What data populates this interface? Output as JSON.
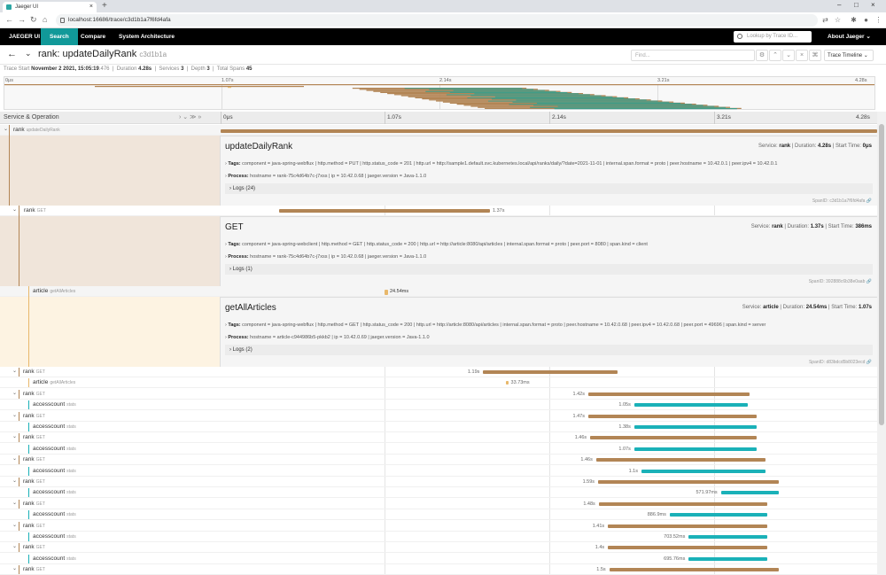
{
  "browser": {
    "tab_title": "Jaeger UI",
    "url": "localhost:16686/trace/c3d1b1a7f6fd4afa"
  },
  "nav": {
    "brand": "JAEGER UI",
    "items": [
      "Search",
      "Compare",
      "System Architecture"
    ],
    "lookup_placeholder": "Lookup by Trace ID...",
    "about": "About Jaeger"
  },
  "trace": {
    "service": "rank",
    "name": "rank: updateDailyRank",
    "short_id": "c3d1b1a",
    "find_placeholder": "Find...",
    "view": "Trace Timeline",
    "meta": {
      "start_label": "Trace Start",
      "start": "November 2 2021, 15:05:19",
      "start_ms": ".476",
      "duration_label": "Duration",
      "duration": "4.28s",
      "services_label": "Services",
      "services": "3",
      "depth_label": "Depth",
      "depth": "3",
      "spans_label": "Total Spans",
      "spans": "45"
    }
  },
  "minimap": {
    "ticks": [
      "0μs",
      "1.07s",
      "2.14s",
      "3.21s",
      "4.28s"
    ]
  },
  "timeline": {
    "header": "Service & Operation",
    "ticks": [
      "0μs",
      "1.07s",
      "2.14s",
      "3.21s",
      "4.28s"
    ]
  },
  "spans": [
    {
      "service": "rank",
      "op": "updateDailyRank",
      "title": "updateDailyRank",
      "svc_label": "Service:",
      "svc": "rank",
      "dur_label": "Duration:",
      "dur": "4.28s",
      "start_label": "Start Time:",
      "start": "0μs",
      "tags_label": "Tags:",
      "tags": "component = java-spring-webflux   |   http.method = PUT   |   http.status_code = 201   |   http.url = http://sample1.default.svc.kubernetes.local/api/ranks/daily/?date=2021-11-01   |   internal.span.format = proto   |   peer.hostname = 10.42.0.1   |   peer.ipv4 = 10.42.0.1",
      "process_label": "Process:",
      "process": "hostname = rank-75c4d64b7c-j7xss   |   ip = 10.42.0.68   |   jaeger.version = Java-1.1.0",
      "logs_label": "Logs",
      "logs": "(24)",
      "spanid_label": "SpanID:",
      "spanid": "c3d1b1a7f6fd4afa"
    },
    {
      "service": "rank",
      "op": "GET",
      "title": "GET",
      "bar": "1.37s",
      "svc_label": "Service:",
      "svc": "rank",
      "dur_label": "Duration:",
      "dur": "1.37s",
      "start_label": "Start Time:",
      "start": "386ms",
      "tags_label": "Tags:",
      "tags": "component = java-spring-webclient   |   http.method = GET   |   http.status_code = 200   |   http.url = http://article:8080/api/articles   |   internal.span.format = proto   |   peer.port = 8080   |   span.kind = client",
      "process_label": "Process:",
      "process": "hostname = rank-75c4d64b7c-j7xss   |   ip = 10.42.0.68   |   jaeger.version = Java-1.1.0",
      "logs_label": "Logs",
      "logs": "(1)",
      "spanid_label": "SpanID:",
      "spanid": "392888c6b38e0aab"
    },
    {
      "service": "article",
      "op": "getAllArticles",
      "title": "getAllArticles",
      "bar": "24.54ms",
      "svc_label": "Service:",
      "svc": "article",
      "dur_label": "Duration:",
      "dur": "24.54ms",
      "start_label": "Start Time:",
      "start": "1.07s",
      "tags_label": "Tags:",
      "tags": "component = java-spring-webflux   |   http.method = GET   |   http.status_code = 200   |   http.url = http://article:8080/api/articles   |   internal.span.format = proto   |   peer.hostname = 10.42.0.68   |   peer.ipv4 = 10.42.0.68   |   peer.port = 49696   |   span.kind = server",
      "process_label": "Process:",
      "process": "hostname = article-c944986b5-pkkb2   |   ip = 10.42.0.69   |   jaeger.version = Java-1.1.0",
      "logs_label": "Logs",
      "logs": "(2)",
      "spanid_label": "SpanID:",
      "spanid": "d83bdcd5b8023ecd"
    }
  ],
  "rows": [
    {
      "service": "rank",
      "op": "GET",
      "label": "1.19s",
      "start": 0.4,
      "end": 0.605,
      "kind": "rank",
      "child": false
    },
    {
      "service": "article",
      "op": "getAllArticles",
      "label": "33.73ms",
      "start": 0.4345,
      "end": 0.438,
      "kind": "art",
      "child": true
    },
    {
      "service": "rank",
      "op": "GET",
      "label": "1.42s",
      "start": 0.56,
      "end": 0.806,
      "kind": "rank",
      "child": false
    },
    {
      "service": "accesscount",
      "op": "stats",
      "label": "1.05s",
      "start": 0.63,
      "end": 0.803,
      "kind": "acc",
      "child": true
    },
    {
      "service": "rank",
      "op": "GET",
      "label": "1.47s",
      "start": 0.56,
      "end": 0.816,
      "kind": "rank",
      "child": false
    },
    {
      "service": "accesscount",
      "op": "stats",
      "label": "1.38s",
      "start": 0.63,
      "end": 0.816,
      "kind": "acc",
      "child": true
    },
    {
      "service": "rank",
      "op": "GET",
      "label": "1.46s",
      "start": 0.563,
      "end": 0.816,
      "kind": "rank",
      "child": false
    },
    {
      "service": "accesscount",
      "op": "stats",
      "label": "1.07s",
      "start": 0.63,
      "end": 0.816,
      "kind": "acc",
      "child": true
    },
    {
      "service": "rank",
      "op": "GET",
      "label": "1.46s",
      "start": 0.572,
      "end": 0.83,
      "kind": "rank",
      "child": false
    },
    {
      "service": "accesscount",
      "op": "stats",
      "label": "1.1s",
      "start": 0.641,
      "end": 0.83,
      "kind": "acc",
      "child": true
    },
    {
      "service": "rank",
      "op": "GET",
      "label": "1.59s",
      "start": 0.575,
      "end": 0.85,
      "kind": "rank",
      "child": false
    },
    {
      "service": "accesscount",
      "op": "stats",
      "label": "571.97ms",
      "start": 0.762,
      "end": 0.85,
      "kind": "acc",
      "child": true
    },
    {
      "service": "rank",
      "op": "GET",
      "label": "1.48s",
      "start": 0.576,
      "end": 0.832,
      "kind": "rank",
      "child": false
    },
    {
      "service": "accesscount",
      "op": "stats",
      "label": "886.9ms",
      "start": 0.684,
      "end": 0.832,
      "kind": "acc",
      "child": true
    },
    {
      "service": "rank",
      "op": "GET",
      "label": "1.41s",
      "start": 0.59,
      "end": 0.832,
      "kind": "rank",
      "child": false
    },
    {
      "service": "accesscount",
      "op": "stats",
      "label": "703.52ms",
      "start": 0.713,
      "end": 0.832,
      "kind": "acc",
      "child": true
    },
    {
      "service": "rank",
      "op": "GET",
      "label": "1.4s",
      "start": 0.59,
      "end": 0.832,
      "kind": "rank",
      "child": false
    },
    {
      "service": "accesscount",
      "op": "stats",
      "label": "695.76ms",
      "start": 0.713,
      "end": 0.832,
      "kind": "acc",
      "child": true
    },
    {
      "service": "rank",
      "op": "GET",
      "label": "1.5s",
      "start": 0.592,
      "end": 0.85,
      "kind": "rank",
      "child": false
    }
  ],
  "colors": {
    "rank": "#b28555",
    "accesscount": "#1ab1b8",
    "article": "#e8b86b",
    "nav_active": "#119999"
  }
}
